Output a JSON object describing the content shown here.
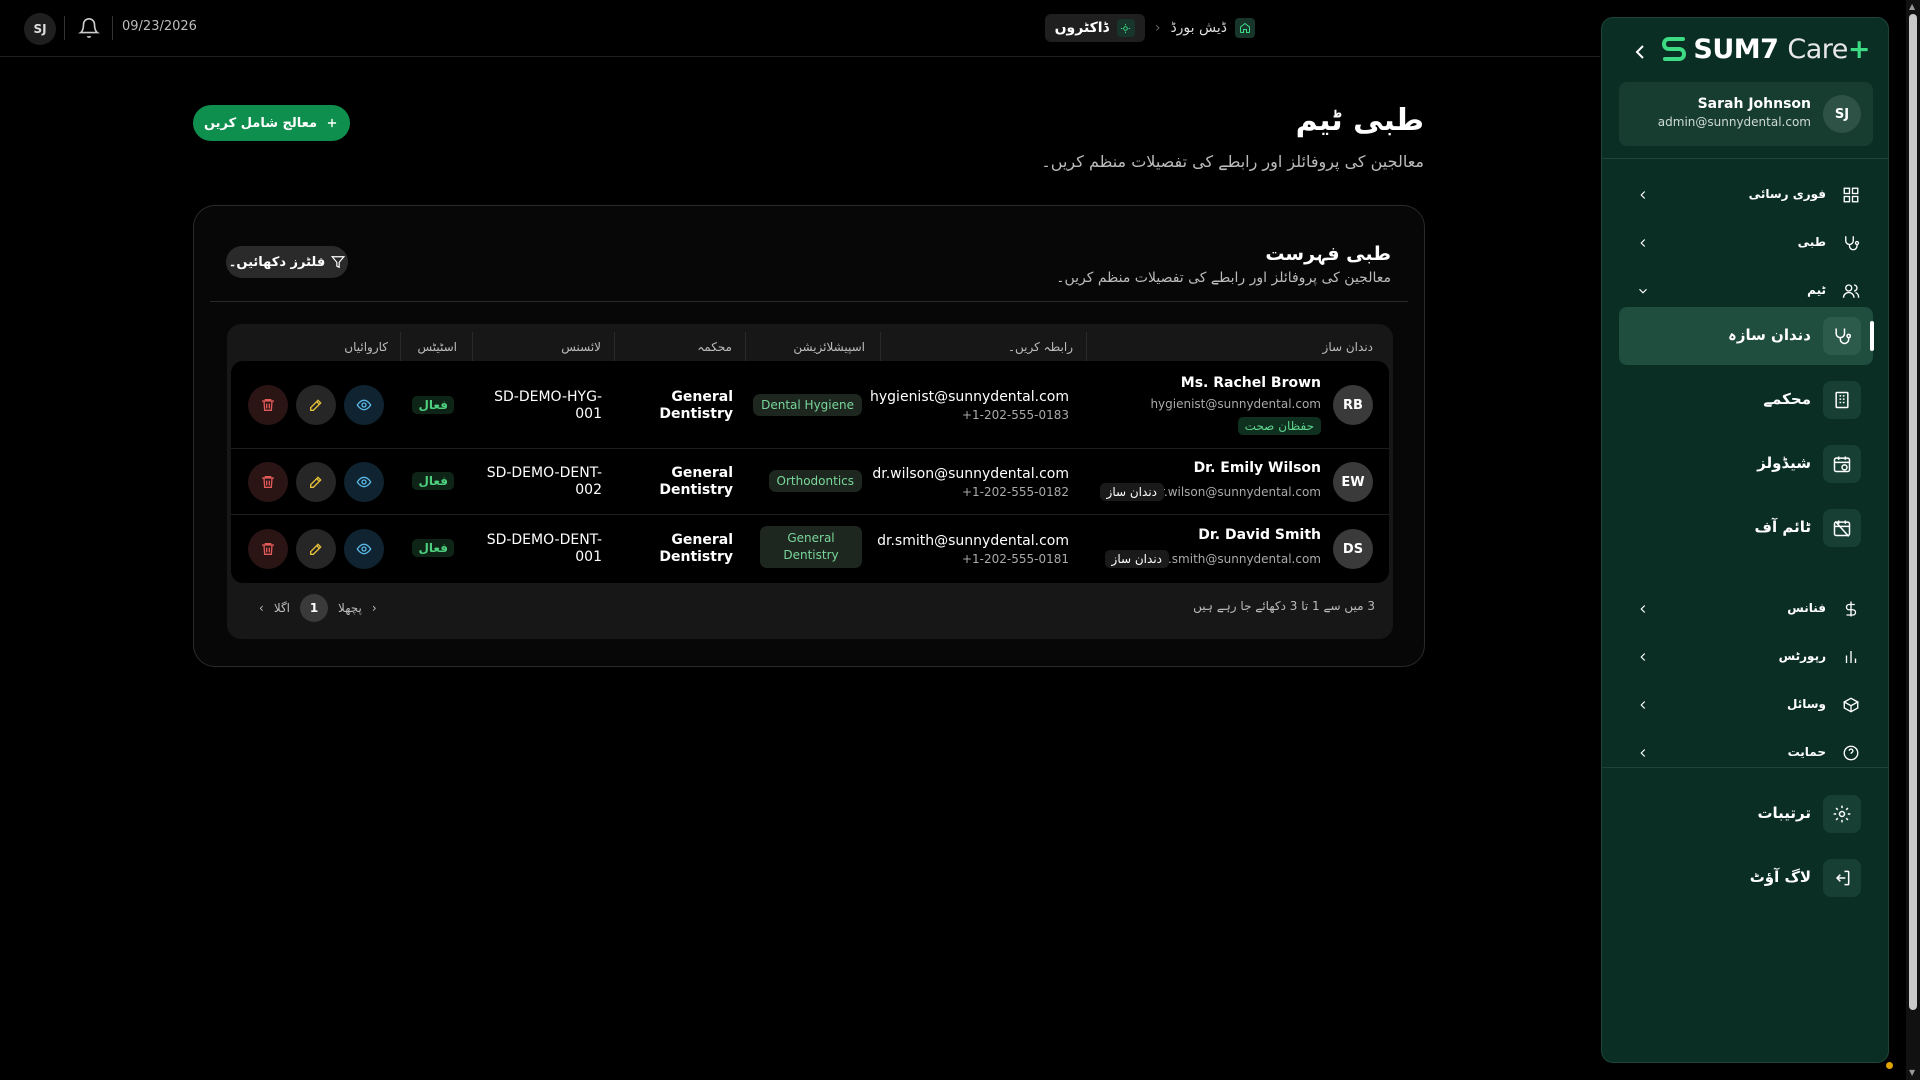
{
  "topbar": {
    "avatar_initials": "SJ",
    "date": "09/23/2026",
    "breadcrumb": {
      "home": "ڈیش بورڈ",
      "current": "ڈاکٹروں"
    }
  },
  "page": {
    "title": "طبی ٹیم",
    "subtitle": "معالجین کی پروفائلز اور رابطے کی تفصیلات منظم کریں۔",
    "add_button": "معالج شامل کریں"
  },
  "card": {
    "title": "طبی فہرست",
    "subtitle": "معالجین کی پروفائلز اور رابطے کی تفصیلات منظم کریں۔",
    "filter_button": "فلٹرز دکھائیں۔"
  },
  "table": {
    "headers": {
      "dentist": "دندان ساز",
      "contact": "رابطہ کریں۔",
      "specialization": "اسپیشلائزیشن",
      "department": "محکمہ",
      "license": "لائسنس",
      "status": "اسٹیٹس",
      "actions": "کاروائیاں"
    },
    "rows": [
      {
        "initials": "RB",
        "name": "Ms. Rachel Brown",
        "email": "hygienist@sunnydental.com",
        "role": "حفظان صحت",
        "contact_email": "hygienist@sunnydental.com",
        "phone": "+1-202-555-0183",
        "specialization": "Dental Hygiene",
        "department": "General Dentistry",
        "license": "SD-DEMO-HYG-001",
        "status": "فعال"
      },
      {
        "initials": "EW",
        "name": "Dr. Emily Wilson",
        "email": "dr.wilson@sunnydental.com",
        "role": "دندان ساز",
        "contact_email": "dr.wilson@sunnydental.com",
        "phone": "+1-202-555-0182",
        "specialization": "Orthodontics",
        "department": "General Dentistry",
        "license": "SD-DEMO-DENT-002",
        "status": "فعال"
      },
      {
        "initials": "DS",
        "name": "Dr. David Smith",
        "email": "dr.smith@sunnydental.com",
        "role": "دندان ساز",
        "contact_email": "dr.smith@sunnydental.com",
        "phone": "+1-202-555-0181",
        "specialization": "General Dentistry",
        "department": "General Dentistry",
        "license": "SD-DEMO-DENT-001",
        "status": "فعال"
      }
    ],
    "pagination": {
      "info": "3 میں سے 1 تا 3 دکھائے جا رہے ہیں",
      "prev": "پچھلا",
      "page": "1",
      "next": "اگلا"
    }
  },
  "sidebar": {
    "logo": {
      "brand": "SUM7",
      "care": "Care",
      "plus": "+"
    },
    "user": {
      "initials": "SJ",
      "name": "Sarah Johnson",
      "email": "admin@sunnydental.com"
    },
    "nav": {
      "quick_access": "فوری رسائی",
      "medical": "طبی",
      "team": "ٹیم",
      "team_items": [
        "دندان سازہ",
        "محکمے",
        "شیڈولز",
        "ٹائم آف"
      ],
      "finance": "فنانس",
      "reports": "رپورٹس",
      "resources": "وسائل",
      "support": "حمایت",
      "settings": "ترتیبات",
      "logout": "لاگ آؤٹ"
    }
  },
  "colors": {
    "accent_green": "#0f8f4d",
    "sidebar_bg": "#0a2e24",
    "status_green": "#4fd07f"
  }
}
